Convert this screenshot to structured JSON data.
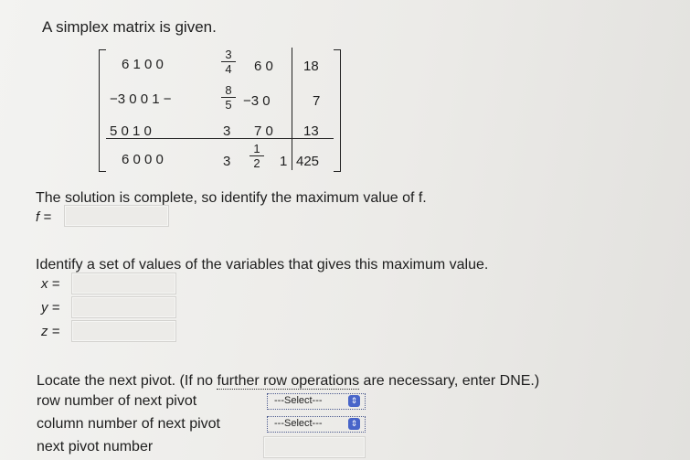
{
  "heading": "A simplex matrix is given.",
  "matrix": {
    "rows": [
      {
        "left": "6 1 0 0",
        "frac": [
          "3",
          "4"
        ],
        "mid": "6 0",
        "rhs": "18"
      },
      {
        "left": "−3 0 0 1 −",
        "frac": [
          "8",
          "5"
        ],
        "mid": "−3 0",
        "rhs": "7"
      },
      {
        "left": "5 0 1 0",
        "c5": "3",
        "mid": "7 0",
        "rhs": "13"
      },
      {
        "left": "6 0 0 0",
        "c5": "3",
        "frac": [
          "1",
          "2"
        ],
        "mid": "1",
        "rhs": "425"
      }
    ]
  },
  "question1": "The solution is complete, so identify the maximum value of f.",
  "f_label": "f =",
  "question2": "Identify a set of values of the variables that gives this maximum value.",
  "vars": [
    {
      "label": "x =",
      "value": ""
    },
    {
      "label": "y =",
      "value": ""
    },
    {
      "label": "z =",
      "value": ""
    }
  ],
  "pivot_prompt_pre": "Locate the next pivot. (If no ",
  "pivot_prompt_link": "further row operations",
  "pivot_prompt_post": " are necessary, enter DNE.)",
  "row_label": "row number of next pivot",
  "col_label": "column number of next pivot",
  "next_label": "next pivot number",
  "select_placeholder": "---Select---",
  "select_arrow": "⇕"
}
